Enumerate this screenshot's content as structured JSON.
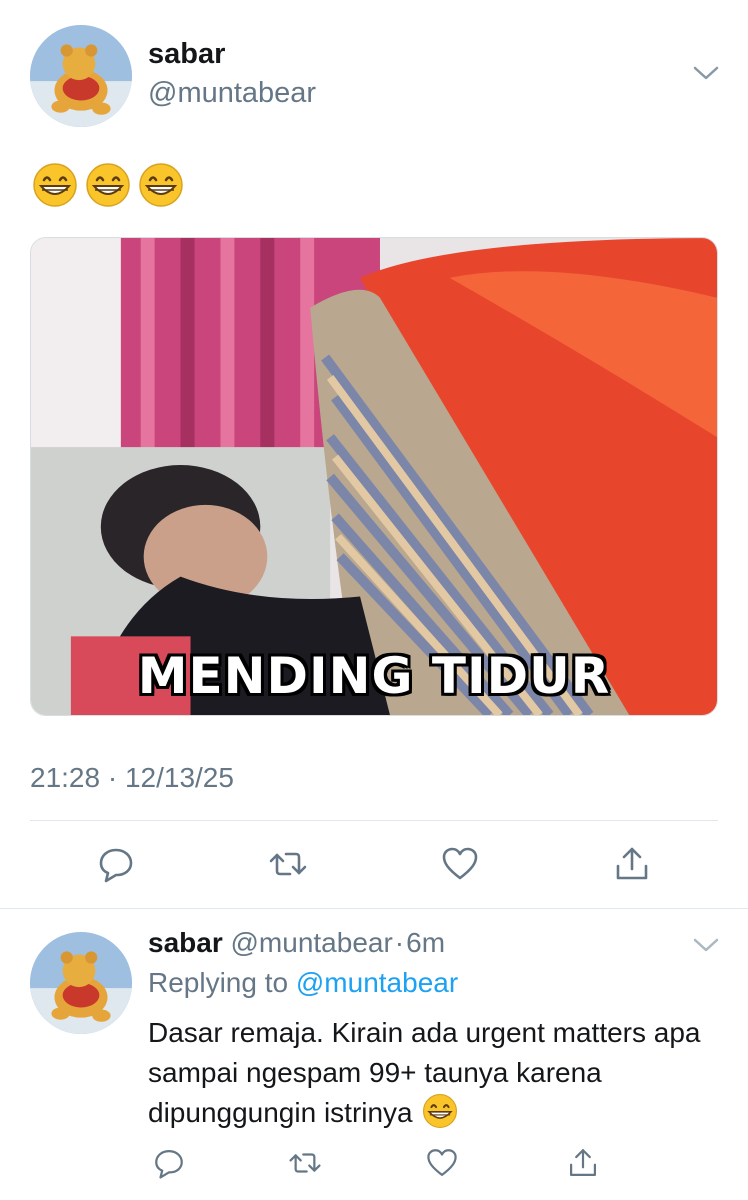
{
  "main_tweet": {
    "display_name": "sabar",
    "handle": "@muntabear",
    "text_emojis": [
      "grinning-face",
      "grinning-face",
      "grinning-face"
    ],
    "media_caption": "MENDING TIDUR",
    "timestamp": "21:28 · 12/13/25"
  },
  "reply": {
    "display_name": "sabar",
    "handle": "@muntabear",
    "separator": "·",
    "age": "6m",
    "replying_prefix": "Replying to",
    "replying_handle": "@muntabear",
    "text": "Dasar remaja. Kirain ada urgent matters apa sampai ngespam 99+ taunya karena dipunggungin istrinya",
    "trailing_emoji": "grinning-face"
  },
  "actions": [
    "reply-icon",
    "retweet-icon",
    "like-icon",
    "share-icon"
  ],
  "colors": {
    "text": "#14171a",
    "secondary": "#657786",
    "link": "#1da1f2",
    "divider": "#e1e8ed"
  }
}
